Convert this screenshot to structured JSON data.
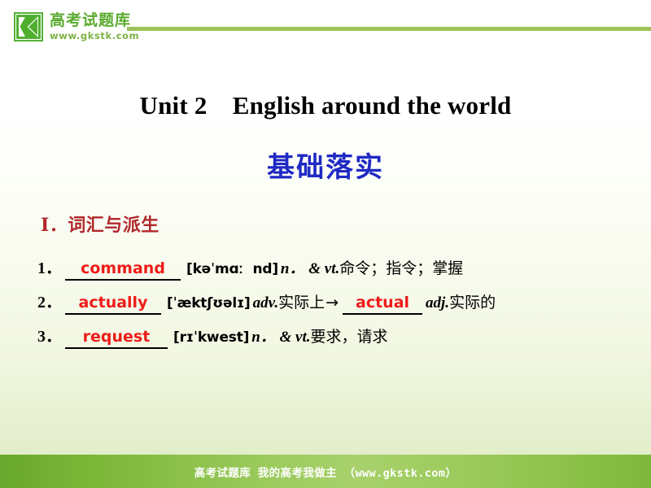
{
  "header": {
    "logo": {
      "icon": "gkstk-k-logo-icon",
      "brand_cn": "高考试题库",
      "brand_url": "www.gkstk.com",
      "brand_color": "#5aaa2e",
      "rule_color": "#9bc158"
    }
  },
  "slide": {
    "title": "Unit 2　English around the world",
    "subtitle": "基础落实",
    "subtitle_color": "#1f29c4",
    "section_heading": "Ⅰ．词汇与派生",
    "section_heading_color": "#b0282b",
    "answer_color": "#ee1c19"
  },
  "vocab": [
    {
      "number": "1．",
      "answer": "command",
      "phonetic": "[kəˈmɑː  nd]",
      "pos": "n．",
      "conj": " & ",
      "pos2": "vt.",
      "meaning": "命令；指令；掌握"
    },
    {
      "number": "2．",
      "answer": "actually",
      "phonetic": "[ˈæktʃʊəlɪ]",
      "pos": "adv.",
      "meaning": "实际上",
      "arrow": "→",
      "derived_answer": "actual",
      "derived_pos": "adj.",
      "derived_meaning": "实际的"
    },
    {
      "number": "3．",
      "answer": "request",
      "phonetic": "[rɪˈkwest]",
      "pos": "n．",
      "conj": " & ",
      "pos2": "vt.",
      "meaning": "要求，请求"
    }
  ],
  "footer": {
    "text": "高考试题库 我的高考我做主 （www.gkstk.com）"
  }
}
